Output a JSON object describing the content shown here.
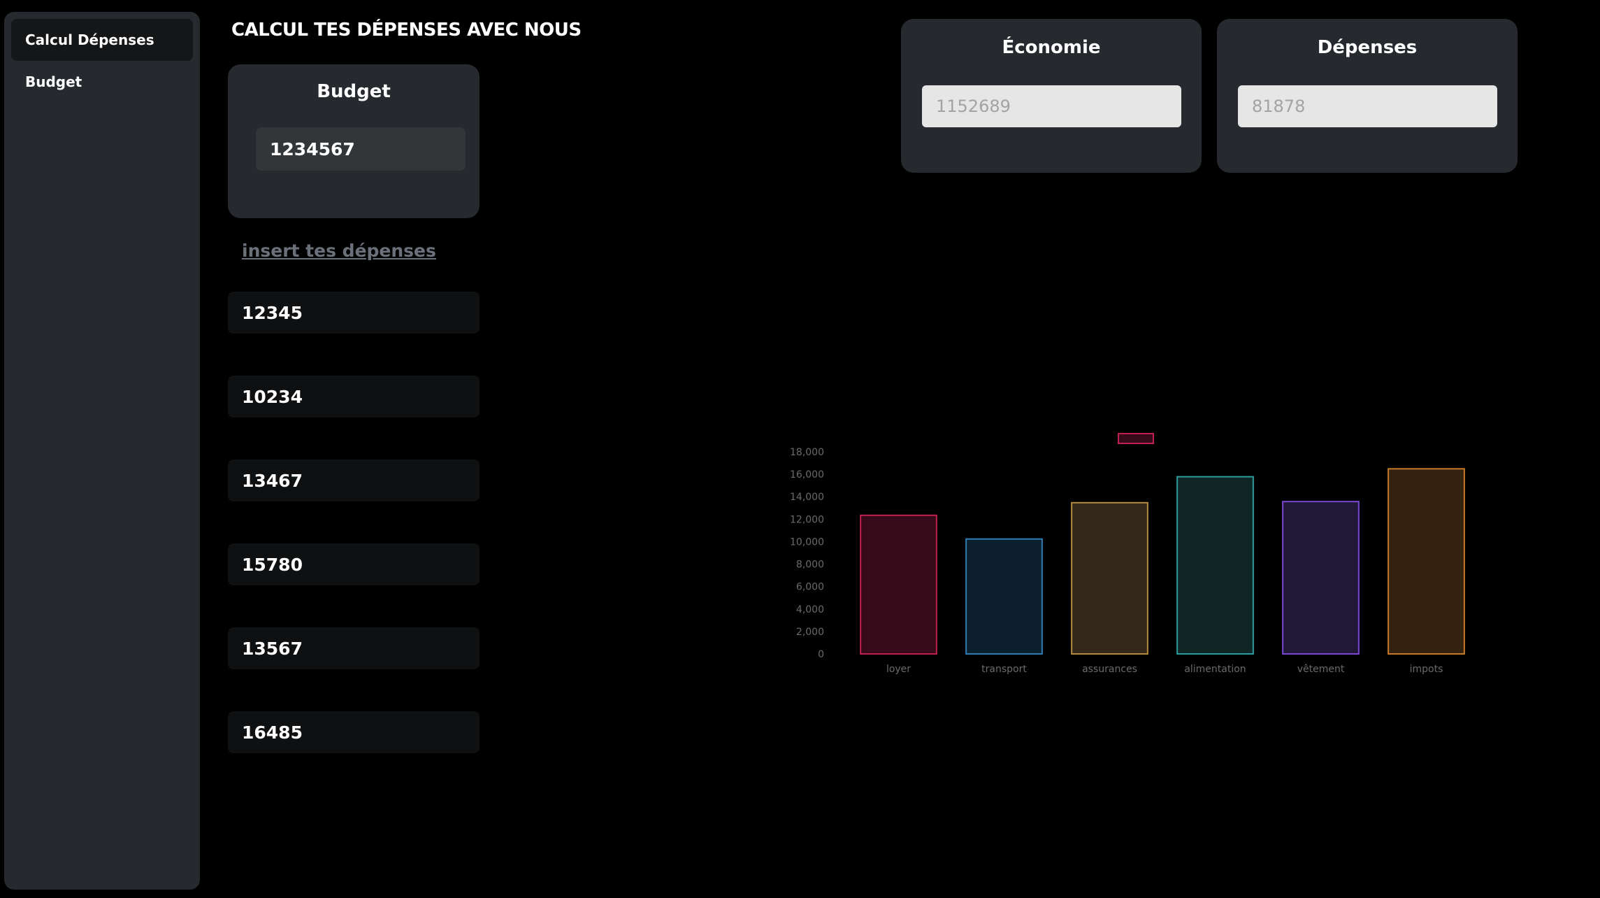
{
  "sidebar": {
    "items": [
      {
        "label": "Calcul Dépenses",
        "active": true
      },
      {
        "label": "Budget",
        "active": false
      }
    ]
  },
  "header": {
    "title": "CALCUL TES DÉPENSES AVEC NOUS"
  },
  "budget": {
    "title": "Budget",
    "value": "1234567"
  },
  "economie": {
    "title": "Économie",
    "placeholder": "1152689"
  },
  "depenses": {
    "title": "Dépenses",
    "placeholder": "81878"
  },
  "insert_link": "insert tes dépenses",
  "expenses": [
    "12345",
    "10234",
    "13467",
    "15780",
    "13567",
    "16485"
  ],
  "chart_data": {
    "type": "bar",
    "categories": [
      "loyer",
      "transport",
      "assurances",
      "alimentation",
      "vêtement",
      "impots"
    ],
    "series": [
      {
        "values": [
          12345,
          10234,
          13467,
          15780,
          13567,
          16485
        ]
      }
    ],
    "colors": {
      "fill": [
        "#360a18",
        "#0b1f2d",
        "#33281a",
        "#0f2526",
        "#201836",
        "#33220f"
      ],
      "border": [
        "#c0204f",
        "#2e7cb2",
        "#b38a3e",
        "#2a9c9c",
        "#7a48d0",
        "#c77a2a"
      ]
    },
    "ylim": [
      0,
      18000
    ],
    "yticks": [
      "0",
      "2,000",
      "4,000",
      "6,000",
      "8,000",
      "10,000",
      "12,000",
      "14,000",
      "16,000",
      "18,000"
    ],
    "grid": false,
    "legend": "top"
  }
}
